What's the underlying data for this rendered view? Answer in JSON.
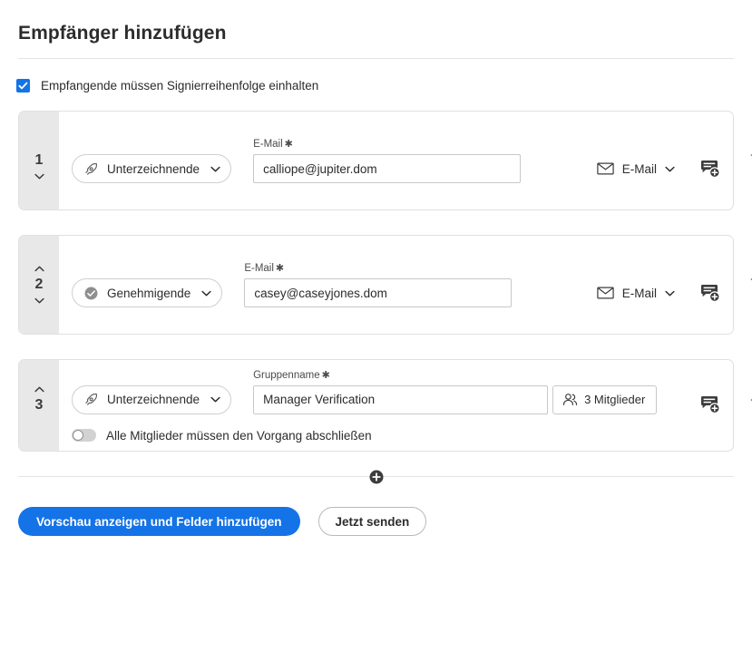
{
  "header": {
    "title": "Empfänger hinzufügen"
  },
  "signing_order": {
    "label": "Empfangende müssen Signierreihenfolge einhalten",
    "checked": true,
    "accent_color": "#1473E6"
  },
  "icons": {
    "checkbox_check": "check-icon",
    "signer": "pen-nib-icon",
    "approver": "check-circle-icon",
    "email": "envelope-icon",
    "chevron_down": "chevron-down-icon",
    "chevron_up": "chevron-up-icon",
    "note": "add-note-icon",
    "delete": "trash-icon",
    "members": "people-icon",
    "add": "plus-icon"
  },
  "recipients": [
    {
      "order": "1",
      "role": "Unterzeichnende",
      "role_icon": "pen-nib-icon",
      "field_label": "E-Mail",
      "required_mark": "✱",
      "value": "calliope@jupiter.dom",
      "placeholder": "E-Mail",
      "delivery": "E-Mail",
      "move_up": false,
      "move_down": true,
      "members_button": null,
      "toggle": null
    },
    {
      "order": "2",
      "role": "Genehmigende",
      "role_icon": "check-circle-icon",
      "field_label": "E-Mail",
      "required_mark": "✱",
      "value": "casey@caseyjones.dom",
      "placeholder": "E-Mail",
      "delivery": "E-Mail",
      "move_up": true,
      "move_down": true,
      "members_button": null,
      "toggle": null
    },
    {
      "order": "3",
      "role": "Unterzeichnende",
      "role_icon": "pen-nib-icon",
      "field_label": "Gruppenname",
      "required_mark": "✱",
      "value": "Manager Verification",
      "placeholder": "Gruppenname",
      "delivery": null,
      "move_up": true,
      "move_down": false,
      "members_button": "3 Mitglieder",
      "toggle": {
        "label": "Alle Mitglieder müssen den Vorgang abschließen",
        "on": false
      }
    }
  ],
  "footer": {
    "primary_label": "Vorschau anzeigen und Felder hinzufügen",
    "secondary_label": "Jetzt senden",
    "primary_color": "#1473E6"
  }
}
